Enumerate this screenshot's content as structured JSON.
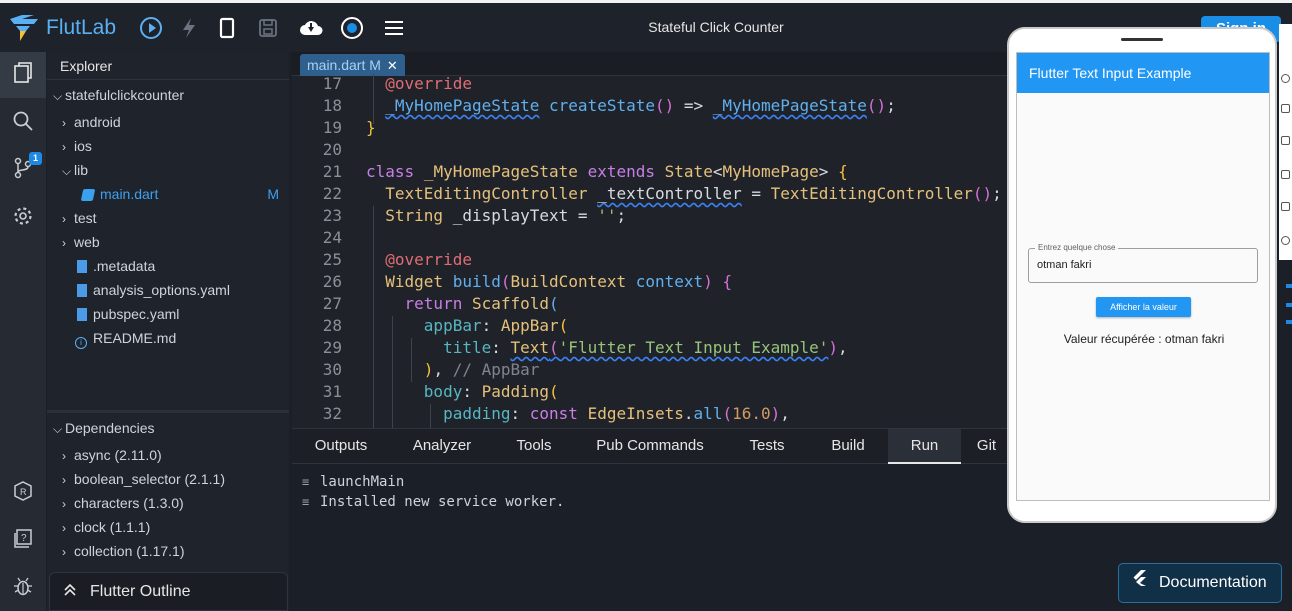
{
  "app": {
    "name": "FlutLab",
    "title": "Stateful Click Counter",
    "signin_label": "Sign in"
  },
  "colors": {
    "accent": "#1a8de6",
    "background": "#1b1f27",
    "phone_appbar": "#2196f3"
  },
  "activity_bar": {
    "items": [
      {
        "icon": "files-icon"
      },
      {
        "icon": "search-icon"
      },
      {
        "icon": "source-control-icon",
        "badge": "1"
      },
      {
        "icon": "settings-icon"
      },
      {
        "icon": "registry-icon"
      },
      {
        "icon": "help-icon"
      },
      {
        "icon": "debug-icon"
      }
    ]
  },
  "explorer": {
    "header": "Explorer",
    "project": "statefulclickcounter",
    "items": [
      {
        "label": "android"
      },
      {
        "label": "ios"
      },
      {
        "label": "lib"
      },
      {
        "label": "main.dart",
        "status": "M"
      },
      {
        "label": "test"
      },
      {
        "label": "web"
      },
      {
        "label": ".metadata"
      },
      {
        "label": "analysis_options.yaml"
      },
      {
        "label": "pubspec.yaml"
      },
      {
        "label": "README.md"
      }
    ],
    "dependencies_header": "Dependencies",
    "dependencies": [
      "async (2.11.0)",
      "boolean_selector (2.1.1)",
      "characters (1.3.0)",
      "clock (1.1.1)",
      "collection (1.17.1)"
    ],
    "outline_label": "Flutter Outline"
  },
  "editor": {
    "tab_label": "main.dart M",
    "line_numbers": [
      "17",
      "18",
      "19",
      "20",
      "21",
      "22",
      "23",
      "24",
      "25",
      "26",
      "27",
      "28",
      "29",
      "30",
      "31",
      "32"
    ]
  },
  "bottom_panel": {
    "tabs": [
      "Outputs",
      "Analyzer",
      "Tools",
      "Pub Commands",
      "Tests",
      "Build",
      "Run",
      "Git"
    ],
    "active_tab": "Run",
    "console_lines": [
      "launchMain",
      "Installed new service worker."
    ]
  },
  "phone": {
    "appbar_title": "Flutter Text Input Example",
    "field_label": "Entrez quelque chose",
    "field_value": "otman fakri",
    "button_label": "Afficher la valeur",
    "result_text": "Valeur récupérée : otman fakri"
  },
  "documentation_label": "Documentation"
}
